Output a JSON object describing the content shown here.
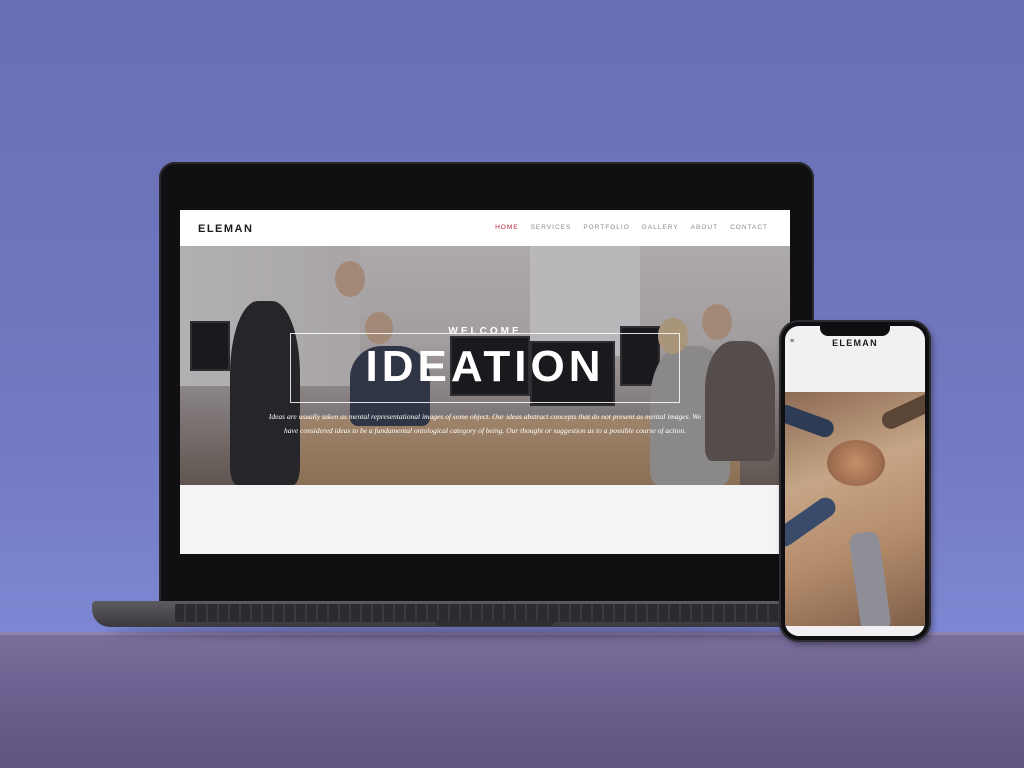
{
  "laptop_site": {
    "logo": "ELEMAN",
    "nav": [
      "HOME",
      "SERVICES",
      "PORTFOLIO",
      "GALLERY",
      "ABOUT",
      "CONTACT"
    ],
    "active_nav": "HOME",
    "hero": {
      "welcome": "WELCOME",
      "title": "IDEATION",
      "description": "Ideas are usually taken as mental representational images of some object. Our ideas abstract concepts that do not present as mental images. We have considered ideas to be a fundamental ontological category of being. Our thought or suggestion as to a possible course of action."
    }
  },
  "phone_site": {
    "logo": "ELEMAN",
    "menu_icon": "hamburger-icon"
  },
  "colors": {
    "background": "#7279c2",
    "accent": "#b5253e",
    "nav_text": "#8a8a8a"
  }
}
